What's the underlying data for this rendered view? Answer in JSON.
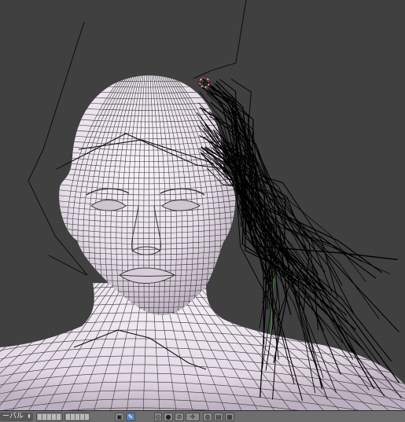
{
  "viewport": {
    "background": "#404040",
    "mesh_color": "#2a2a2a",
    "skin_light": "#f4eef5",
    "skin_shadow": "#b9adbd",
    "hair_curve_color": "#000000",
    "axis_line_color": "#3fa33f",
    "cursor_color": "#cc3333"
  },
  "header": {
    "mode_label": "ーバル",
    "icons": [
      {
        "name": "layers-icon",
        "glyph": ""
      },
      {
        "name": "view-layer-grid-icon",
        "glyph": ""
      },
      {
        "name": "object-type-icon",
        "glyph": "▣"
      },
      {
        "name": "brush-curve-icon",
        "glyph": "✎"
      },
      {
        "name": "select-mode-icon",
        "glyph": "◎"
      },
      {
        "name": "pivot-point-icon",
        "glyph": "●"
      },
      {
        "name": "snap-icon",
        "glyph": "⊘"
      },
      {
        "name": "transform-manipulator-icon",
        "glyph": "✛"
      },
      {
        "name": "proportional-edit-icon",
        "glyph": "◍"
      },
      {
        "name": "render-camera-icon",
        "glyph": "▤"
      },
      {
        "name": "render-animation-icon",
        "glyph": "▦"
      }
    ]
  }
}
